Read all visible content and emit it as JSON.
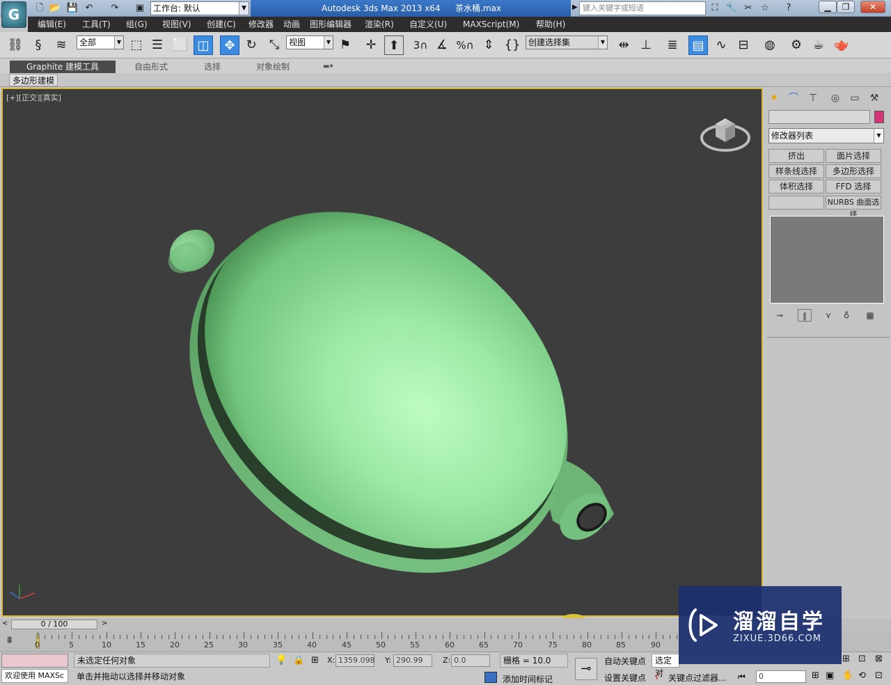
{
  "quick_access": {
    "workspace_label": "工作台: 默认"
  },
  "title": {
    "app": "Autodesk 3ds Max  2013 x64",
    "file": "茶水桶.max"
  },
  "search": {
    "placeholder": "键入关键字或短语"
  },
  "menu": [
    "编辑(E)",
    "工具(T)",
    "组(G)",
    "视图(V)",
    "创建(C)",
    "修改器",
    "动画",
    "图形编辑器",
    "渲染(R)",
    "自定义(U)",
    "MAXScript(M)",
    "帮助(H)"
  ],
  "toolbar": {
    "filter_select": "全部",
    "ref_coord": "视图",
    "snap_3": "3",
    "snap_percent": "%",
    "named_selection": "创建选择集"
  },
  "ribbon": {
    "tabs": [
      "Graphite 建模工具",
      "自由形式",
      "选择",
      "对象绘制"
    ],
    "sub_tab": "多边形建模"
  },
  "viewport": {
    "label": "[+][正交][真实]"
  },
  "command_panel": {
    "modifier_list": "修改器列表",
    "modifier_buttons": [
      "挤出",
      "面片选择",
      "样条线选择",
      "多边形选择",
      "体积选择",
      "FFD 选择",
      "",
      "NURBS 曲面选择"
    ],
    "object_color": "#d3347a"
  },
  "timeline": {
    "position": "0 / 100",
    "labels": [
      "0",
      "5",
      "10",
      "15",
      "20",
      "25",
      "30",
      "35",
      "40",
      "45",
      "50",
      "55",
      "60",
      "65",
      "70",
      "75",
      "80",
      "85",
      "90"
    ]
  },
  "status": {
    "maxscript_welcome": "欢迎使用 MAXSc",
    "selection_info": "未选定任何对象",
    "prompt": "单击并拖动以选择并移动对象",
    "x_label": "X:",
    "x_value": "1359.098",
    "y_label": "Y:",
    "y_value": "290.99",
    "z_label": "Z:",
    "z_value": "0.0",
    "grid": "栅格 = 10.0",
    "auto_key": "自动关键点",
    "set_key": "设置关键点",
    "selected": "选定对",
    "key_filters": "关键点过滤器...",
    "add_time_tag": "添加时间标记",
    "frame_value": "0"
  },
  "watermark": {
    "title": "溜溜自学",
    "url": "ZIXUE.3D66.COM"
  },
  "colors": {
    "viewport_bg": "#3d3d3d",
    "object_green": "#8fdc96",
    "viewport_border": "#d9b441"
  }
}
